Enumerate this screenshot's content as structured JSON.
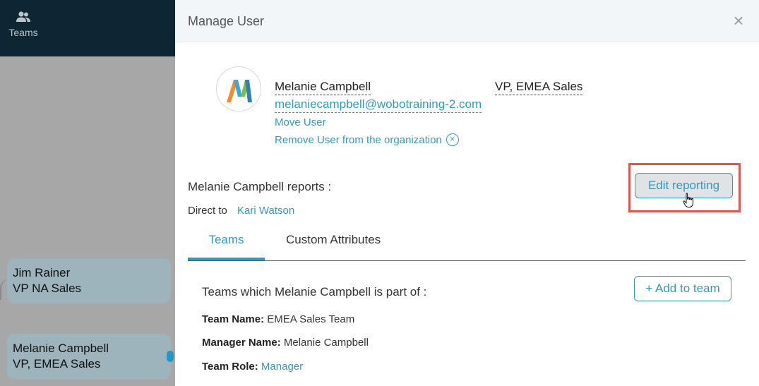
{
  "nav": {
    "teams_label": "Teams"
  },
  "org_chart": {
    "nodes": [
      {
        "name": "Jim Rainer",
        "title": "VP NA Sales"
      },
      {
        "name": "Melanie Campbell",
        "title": "VP, EMEA Sales"
      }
    ]
  },
  "modal": {
    "title": "Manage User",
    "close_symbol": "×",
    "user": {
      "name": "Melanie Campbell",
      "title": "VP, EMEA Sales",
      "email": "melaniecampbell@wobotraining-2.com"
    },
    "move_user_label": "Move User",
    "remove_user_label": "Remove User from the organization",
    "remove_symbol": "×",
    "reports_label": "Melanie Campbell reports :",
    "direct_to_label": "Direct to",
    "direct_to_manager": "Kari Watson",
    "edit_reporting_label": "Edit reporting",
    "tabs": [
      {
        "label": "Teams",
        "active": true
      },
      {
        "label": "Custom Attributes",
        "active": false
      }
    ],
    "teams_part_label": "Teams which Melanie Campbell is part of :",
    "add_team_label": "+ Add to team",
    "team": {
      "team_name_label": "Team Name:",
      "team_name": "EMEA Sales Team",
      "manager_name_label": "Manager Name:",
      "manager_name": "Melanie Campbell",
      "team_role_label": "Team Role:",
      "team_role": "Manager"
    }
  },
  "colors": {
    "accent": "#2f9bc0",
    "nav_bg": "#0e2533",
    "highlight": "#e2574c"
  }
}
